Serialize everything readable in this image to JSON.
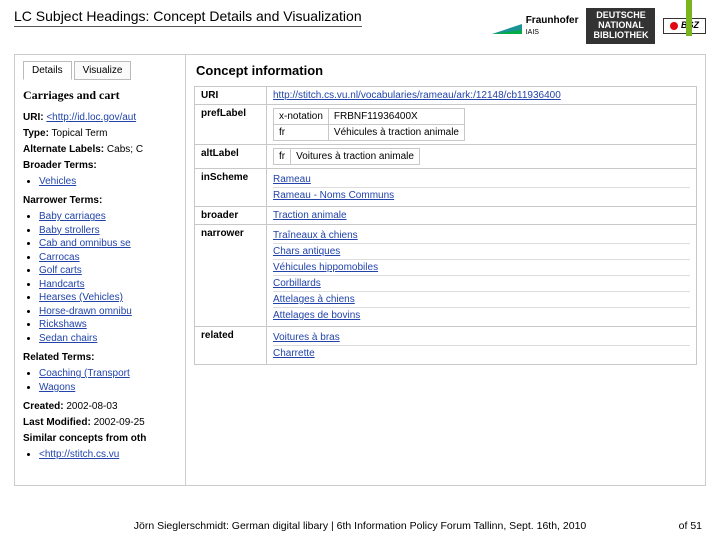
{
  "header": {
    "title": "LC Subject Headings: Concept Details and Visualization",
    "logo1": "Fraunhofer",
    "logo1_sub": "IAIS",
    "logo2_l1": "DEUTSCHE",
    "logo2_l2": "NATIONAL",
    "logo2_l3": "BIBLIOTHEK",
    "logo3": "BSZ"
  },
  "left": {
    "tabs": {
      "details": "Details",
      "visualize": "Visualize"
    },
    "heading": "Carriages and cart",
    "uri_lbl": "URI:",
    "uri_val": "<http://id.loc.gov/aut",
    "type_lbl": "Type:",
    "type_val": "Topical Term",
    "alt_lbl": "Alternate Labels:",
    "alt_val": "Cabs; C",
    "broader_lbl": "Broader Terms:",
    "broader": [
      "Vehicles"
    ],
    "narrower_lbl": "Narrower Terms:",
    "narrower": [
      "Baby carriages",
      "Baby strollers",
      "Cab and omnibus se",
      "Carrocas",
      "Golf carts",
      "Handcarts",
      "Hearses (Vehicles)",
      "Horse-drawn omnibu",
      "Rickshaws",
      "Sedan chairs"
    ],
    "related_lbl": "Related Terms:",
    "related": [
      "Coaching (Transport",
      "Wagons"
    ],
    "created_lbl": "Created:",
    "created_val": "2002-08-03",
    "modified_lbl": "Last Modified:",
    "modified_val": "2002-09-25",
    "similar_lbl": "Similar concepts from oth",
    "similar": [
      "<http://stitch.cs.vu"
    ]
  },
  "right": {
    "title": "Concept information",
    "rows": {
      "uri_k": "URI",
      "uri_v": "http://stitch.cs.vu.nl/vocabularies/rameau/ark:/12148/cb11936400",
      "pref_k": "prefLabel",
      "pref_note": "x-notation",
      "pref_code": "FRBNF11936400X",
      "pref_lang": "fr",
      "pref_label": "Véhicules à traction animale",
      "alt_k": "altLabel",
      "alt_lang": "fr",
      "alt_label": "Voitures à traction animale",
      "scheme_k": "inScheme",
      "scheme": [
        "Rameau",
        "Rameau - Noms Communs"
      ],
      "broader_k": "broader",
      "broader_v": "Traction animale",
      "narrower_k": "narrower",
      "narrower": [
        "Traîneaux à chiens",
        "Chars antiques",
        "Véhicules hippomobiles",
        "Corbillards",
        "Attelages à chiens",
        "Attelages de bovins"
      ],
      "related_k": "related",
      "related": [
        "Voitures à bras",
        "Charrette"
      ]
    }
  },
  "footer": {
    "text": "Jörn Sieglerschmidt: German digital libary | 6th Information Policy Forum Tallinn, Sept. 16th, 2010",
    "of": "of 51"
  }
}
